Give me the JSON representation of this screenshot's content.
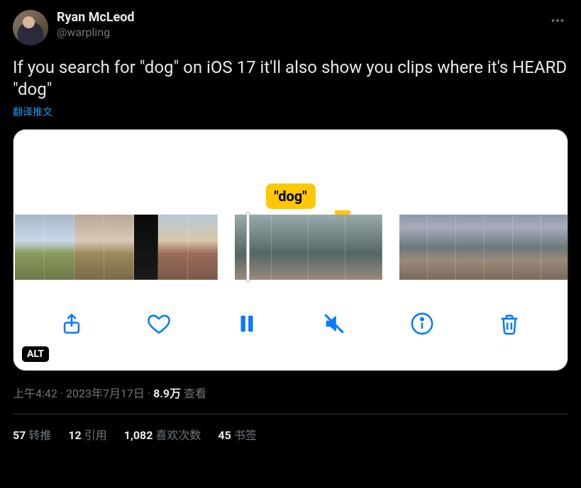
{
  "user": {
    "display_name": "Ryan McLeod",
    "handle": "@warpling"
  },
  "tweet": {
    "text": "If you search for \"dog\" on iOS 17 it'll also show you clips where it's HEARD \"dog\"",
    "translate_label": "翻译推文",
    "search_tag": "\"dog\"",
    "alt_badge": "ALT"
  },
  "meta": {
    "time": "上午4:42",
    "date": "2023年7月17日",
    "views_value": "8.9万",
    "views_label": "查看"
  },
  "stats": {
    "retweets": {
      "value": "57",
      "label": "转推"
    },
    "quotes": {
      "value": "12",
      "label": "引用"
    },
    "likes": {
      "value": "1,082",
      "label": "喜欢次数"
    },
    "bookmarks": {
      "value": "45",
      "label": "书签"
    }
  }
}
